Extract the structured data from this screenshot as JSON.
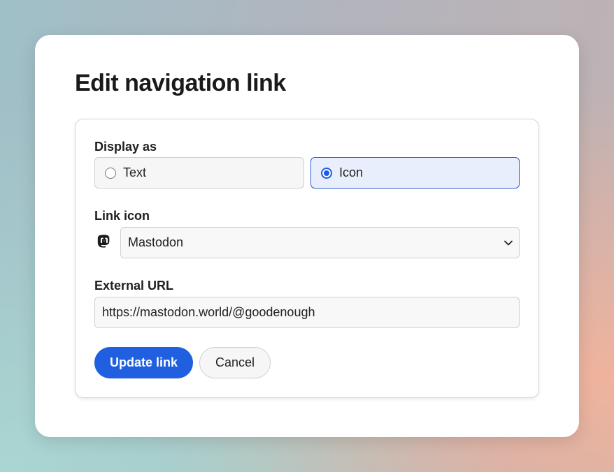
{
  "dialog": {
    "title": "Edit navigation link"
  },
  "display_as": {
    "label": "Display as",
    "options": [
      {
        "label": "Text",
        "selected": false
      },
      {
        "label": "Icon",
        "selected": true
      }
    ]
  },
  "link_icon": {
    "label": "Link icon",
    "icon": "mastodon-icon",
    "selected_value": "Mastodon"
  },
  "external_url": {
    "label": "External URL",
    "value": "https://mastodon.world/@goodenough"
  },
  "actions": {
    "primary_label": "Update link",
    "secondary_label": "Cancel"
  },
  "colors": {
    "accent": "#1f5fe0",
    "selected_bg": "#e8eefc"
  }
}
